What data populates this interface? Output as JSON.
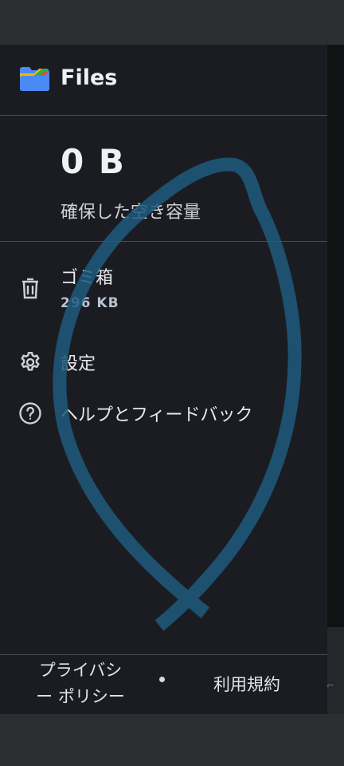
{
  "app": {
    "title": "Files"
  },
  "storage": {
    "size": "0 B",
    "caption": "確保した空き容量"
  },
  "menu": {
    "trash": {
      "label": "ゴミ箱",
      "size": "296 KB"
    },
    "settings": {
      "label": "設定"
    },
    "help": {
      "label": "ヘルプとフィードバック"
    }
  },
  "footer": {
    "privacy_line1": "プライバシ",
    "privacy_line2": "ー ポリシー",
    "terms": "利用規約"
  },
  "colors": {
    "drawer_bg": "#1b1c22",
    "annotation_stroke": "#1d5a7c"
  },
  "icons": [
    "files-logo-icon",
    "trash-icon",
    "gear-icon",
    "help-circle-icon"
  ]
}
